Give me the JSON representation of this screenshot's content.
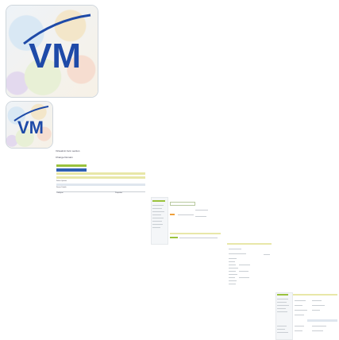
{
  "logo": {
    "text": "VM"
  },
  "panel1": {
    "title": "Virtualmin form section",
    "subtitle": "Change Domain",
    "rows": [
      "Select Options",
      "Server Details",
      "System Information"
    ],
    "footer_left": "Configure",
    "footer_right": "Properties"
  },
  "colors": {
    "brand_blue": "#1e4aa8",
    "accent_green": "#9ac23c",
    "highlight_yellow": "#e8e7a8"
  }
}
